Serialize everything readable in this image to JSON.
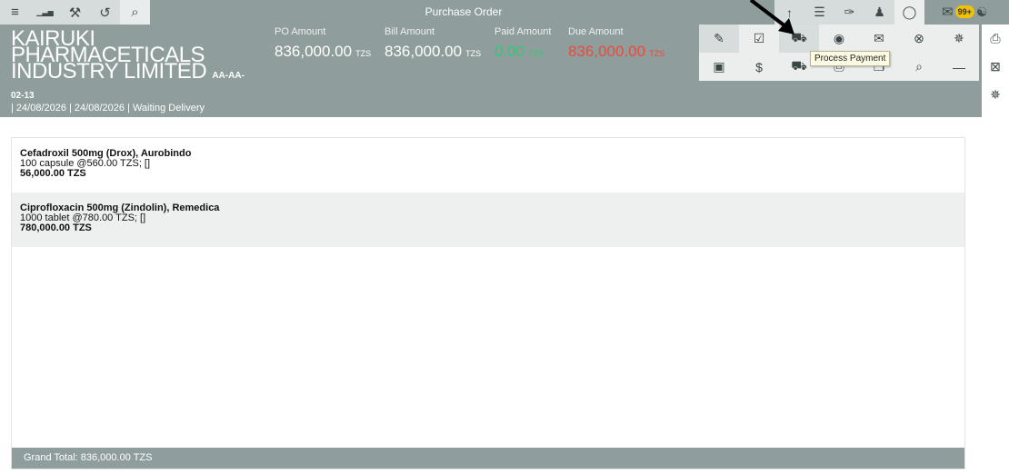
{
  "toolbar_left": [
    {
      "icon": "menu-icon",
      "glyph": "≡"
    },
    {
      "icon": "bar-chart-icon",
      "glyph": "▁▃▅"
    },
    {
      "icon": "wrench-icon",
      "glyph": "⚒"
    },
    {
      "icon": "history-icon",
      "glyph": "↺"
    },
    {
      "icon": "search-icon",
      "glyph": "⌕"
    }
  ],
  "page_title": "Purchase Order",
  "toolbar_right": [
    {
      "icon": "up-arrow-icon",
      "glyph": "↑"
    },
    {
      "icon": "list-icon",
      "glyph": "☰"
    },
    {
      "icon": "tag-icon",
      "glyph": "✑"
    },
    {
      "icon": "user-icon",
      "glyph": "♟"
    },
    {
      "icon": "chat-icon",
      "glyph": "◯"
    }
  ],
  "notifications": {
    "count": "99+"
  },
  "company": {
    "name": "KAIRUKI PHARMACETICALS INDUSTRY LIMITED",
    "code": "AA-AA-",
    "code2": "02-13"
  },
  "order_meta": "| 24/08/2026 | 24/08/2026 | Waiting Delivery",
  "amounts": [
    {
      "label": "PO Amount",
      "value": "836,000.00",
      "currency": "TZS",
      "color": "#ffffff"
    },
    {
      "label": "Bill Amount",
      "value": "836,000.00",
      "currency": "TZS",
      "color": "#ffffff"
    },
    {
      "label": "Paid Amount",
      "value": "0.00",
      "currency": "TZS",
      "color": "#2ecc71"
    },
    {
      "label": "Due Amount",
      "value": "836,000.00",
      "currency": "TZS",
      "color": "#e74c3c"
    }
  ],
  "actions_row1": [
    {
      "icon": "edit-icon",
      "glyph": "✎"
    },
    {
      "icon": "approve-icon",
      "glyph": "☑"
    },
    {
      "icon": "cart-icon",
      "glyph": "⛟"
    },
    {
      "icon": "record-icon",
      "glyph": "◉"
    },
    {
      "icon": "email-icon",
      "glyph": "✉"
    },
    {
      "icon": "cancel-icon",
      "glyph": "⊗"
    },
    {
      "icon": "loading-icon",
      "glyph": "✵"
    }
  ],
  "actions_row2": [
    {
      "icon": "archive-icon",
      "glyph": "▣"
    },
    {
      "icon": "money-icon",
      "glyph": "$"
    },
    {
      "icon": "truck-icon",
      "glyph": "⛟"
    },
    {
      "icon": "print-alt-icon",
      "glyph": "⎙"
    },
    {
      "icon": "copy-icon",
      "glyph": "❐"
    },
    {
      "icon": "zoom-icon",
      "glyph": "⌕"
    },
    {
      "icon": "minus-icon",
      "glyph": "—"
    }
  ],
  "side_actions": [
    {
      "icon": "print-icon",
      "glyph": "⎙"
    },
    {
      "icon": "excel-icon",
      "glyph": "⊠"
    },
    {
      "icon": "spinner-icon",
      "glyph": "✵"
    }
  ],
  "tooltip": "Process Payment",
  "items": [
    {
      "name": "Cefadroxil 500mg (Drox), Aurobindo",
      "detail": "100 capsule @560.00 TZS; []",
      "total": "56,000.00 TZS"
    },
    {
      "name": "Ciprofloxacin 500mg (Zindolin), Remedica",
      "detail": "1000 tablet @780.00 TZS; []",
      "total": "780,000.00 TZS"
    }
  ],
  "grand_total": "Grand Total: 836,000.00 TZS"
}
